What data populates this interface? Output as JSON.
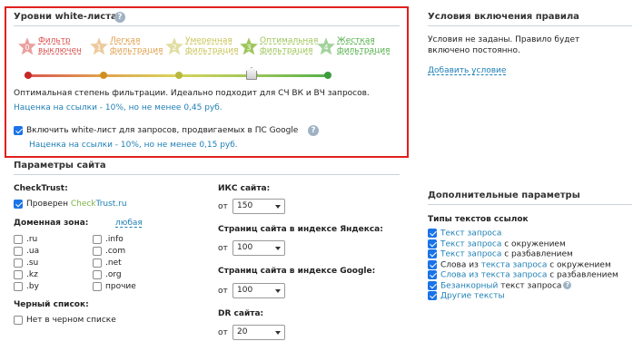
{
  "whitelist": {
    "title": "Уровни white-листа",
    "levels": [
      {
        "num": "0",
        "label1": "Фильтр",
        "label2": "выключен",
        "color": "#d9534f"
      },
      {
        "num": "1",
        "label1": "Легкая",
        "label2": "фильтрация",
        "color": "#e0a050"
      },
      {
        "num": "2",
        "label1": "Умеренная",
        "label2": "фильтрация",
        "color": "#c9c45a"
      },
      {
        "num": "3",
        "label1": "Оптимальная",
        "label2": "фильтрация",
        "color": "#9ec65a"
      },
      {
        "num": "4",
        "label1": "Жесткая",
        "label2": "фильтрация",
        "color": "#55b04a"
      }
    ],
    "selected_level": 3,
    "description": "Оптимальная степень фильтрации. Идеально подходит для СЧ ВК и ВЧ запросов.",
    "price_note": "Наценка на ссылки - 10%, но не менее 0,45 руб.",
    "google_checkbox_label": "Включить white-лист для запросов, продвигаемых в ПС Google",
    "google_checked": true,
    "google_price_note": "Наценка на ссылки - 10%, но не менее 0,15 руб."
  },
  "conditions": {
    "title": "Условия включения правила",
    "text1": "Условия не заданы. Правило будет",
    "text2": "включено постоянно.",
    "add_link": "Добавить условие"
  },
  "site_params": {
    "title": "Параметры сайта",
    "checktrust_title": "CheckTrust:",
    "checked_prefix": "Проверен ",
    "checktrust_check": "Check",
    "checktrust_trust": "Trust",
    "checktrust_ru": ".ru",
    "checktrust_checked": true,
    "domain_zone_title": "Доменная зона:",
    "domain_zone_any": "любая",
    "zones_left": [
      ".ru",
      ".ua",
      ".su",
      ".kz",
      ".by"
    ],
    "zones_right": [
      ".info",
      ".com",
      ".net",
      ".org",
      "прочие"
    ],
    "blacklist_title": "Черный список:",
    "blacklist_label": "Нет в черном списке",
    "iks_title": "ИКС сайта:",
    "iks_prefix": "от",
    "iks_value": "150",
    "yandex_title": "Страниц сайта в индексе Яндекса:",
    "yandex_prefix": "от",
    "yandex_value": "100",
    "google_title": "Страниц сайта в индексе Google:",
    "google_prefix": "от",
    "google_value": "100",
    "dr_title": "DR сайта:",
    "dr_prefix": "от",
    "dr_value": "20"
  },
  "extra": {
    "title": "Дополнительные параметры",
    "types_title": "Типы текстов ссылок",
    "items": [
      {
        "pre": "",
        "link": "Текст запроса",
        "post": ""
      },
      {
        "pre": "",
        "link": "Текст запроса",
        "post": " с окружением"
      },
      {
        "pre": "",
        "link": "Текст запроса",
        "post": " с разбавлением"
      },
      {
        "pre": "Слова из ",
        "link": "текста запроса",
        "post": " с окружением"
      },
      {
        "pre": "",
        "link": "Слова из текста запроса",
        "post": " с разбавлением"
      },
      {
        "pre": "",
        "link": "Безанкорный",
        "post": " текст запроса"
      },
      {
        "pre": "",
        "link": "Другие тексты",
        "post": ""
      }
    ]
  },
  "colors": {
    "highlight_border": "#e0201d",
    "link": "#1e7fb5",
    "checktrust_green": "#7cb342"
  }
}
